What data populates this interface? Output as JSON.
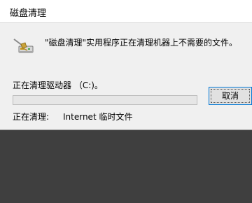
{
  "window": {
    "title": "磁盘清理"
  },
  "dialog": {
    "message": "\"磁盘清理\"实用程序正在清理机器上不需要的文件。",
    "status_label": "正在清理驱动器 （C:)。",
    "progress_fraction": 0.0,
    "cleaning_label": "正在清理:",
    "cleaning_item": "Internet 临时文件"
  },
  "buttons": {
    "cancel_label": "取消"
  },
  "icons": {
    "app": "disk-cleanup-icon"
  },
  "colors": {
    "dialog_bg": "#f0f0f0",
    "button_border": "#0078d7",
    "progress_fill": "#06b025"
  }
}
